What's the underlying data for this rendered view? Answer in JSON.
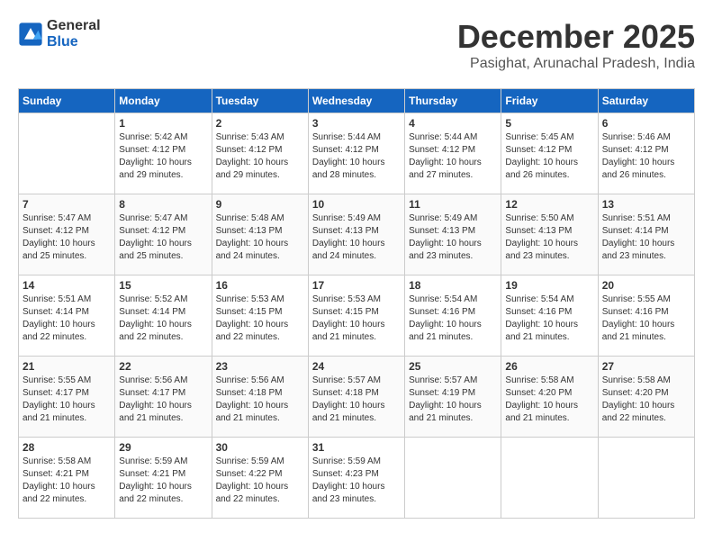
{
  "header": {
    "logo_line1": "General",
    "logo_line2": "Blue",
    "month_title": "December 2025",
    "location": "Pasighat, Arunachal Pradesh, India"
  },
  "weekdays": [
    "Sunday",
    "Monday",
    "Tuesday",
    "Wednesday",
    "Thursday",
    "Friday",
    "Saturday"
  ],
  "weeks": [
    [
      {
        "day": "",
        "info": ""
      },
      {
        "day": "1",
        "info": "Sunrise: 5:42 AM\nSunset: 4:12 PM\nDaylight: 10 hours\nand 29 minutes."
      },
      {
        "day": "2",
        "info": "Sunrise: 5:43 AM\nSunset: 4:12 PM\nDaylight: 10 hours\nand 29 minutes."
      },
      {
        "day": "3",
        "info": "Sunrise: 5:44 AM\nSunset: 4:12 PM\nDaylight: 10 hours\nand 28 minutes."
      },
      {
        "day": "4",
        "info": "Sunrise: 5:44 AM\nSunset: 4:12 PM\nDaylight: 10 hours\nand 27 minutes."
      },
      {
        "day": "5",
        "info": "Sunrise: 5:45 AM\nSunset: 4:12 PM\nDaylight: 10 hours\nand 26 minutes."
      },
      {
        "day": "6",
        "info": "Sunrise: 5:46 AM\nSunset: 4:12 PM\nDaylight: 10 hours\nand 26 minutes."
      }
    ],
    [
      {
        "day": "7",
        "info": "Sunrise: 5:47 AM\nSunset: 4:12 PM\nDaylight: 10 hours\nand 25 minutes."
      },
      {
        "day": "8",
        "info": "Sunrise: 5:47 AM\nSunset: 4:12 PM\nDaylight: 10 hours\nand 25 minutes."
      },
      {
        "day": "9",
        "info": "Sunrise: 5:48 AM\nSunset: 4:13 PM\nDaylight: 10 hours\nand 24 minutes."
      },
      {
        "day": "10",
        "info": "Sunrise: 5:49 AM\nSunset: 4:13 PM\nDaylight: 10 hours\nand 24 minutes."
      },
      {
        "day": "11",
        "info": "Sunrise: 5:49 AM\nSunset: 4:13 PM\nDaylight: 10 hours\nand 23 minutes."
      },
      {
        "day": "12",
        "info": "Sunrise: 5:50 AM\nSunset: 4:13 PM\nDaylight: 10 hours\nand 23 minutes."
      },
      {
        "day": "13",
        "info": "Sunrise: 5:51 AM\nSunset: 4:14 PM\nDaylight: 10 hours\nand 23 minutes."
      }
    ],
    [
      {
        "day": "14",
        "info": "Sunrise: 5:51 AM\nSunset: 4:14 PM\nDaylight: 10 hours\nand 22 minutes."
      },
      {
        "day": "15",
        "info": "Sunrise: 5:52 AM\nSunset: 4:14 PM\nDaylight: 10 hours\nand 22 minutes."
      },
      {
        "day": "16",
        "info": "Sunrise: 5:53 AM\nSunset: 4:15 PM\nDaylight: 10 hours\nand 22 minutes."
      },
      {
        "day": "17",
        "info": "Sunrise: 5:53 AM\nSunset: 4:15 PM\nDaylight: 10 hours\nand 21 minutes."
      },
      {
        "day": "18",
        "info": "Sunrise: 5:54 AM\nSunset: 4:16 PM\nDaylight: 10 hours\nand 21 minutes."
      },
      {
        "day": "19",
        "info": "Sunrise: 5:54 AM\nSunset: 4:16 PM\nDaylight: 10 hours\nand 21 minutes."
      },
      {
        "day": "20",
        "info": "Sunrise: 5:55 AM\nSunset: 4:16 PM\nDaylight: 10 hours\nand 21 minutes."
      }
    ],
    [
      {
        "day": "21",
        "info": "Sunrise: 5:55 AM\nSunset: 4:17 PM\nDaylight: 10 hours\nand 21 minutes."
      },
      {
        "day": "22",
        "info": "Sunrise: 5:56 AM\nSunset: 4:17 PM\nDaylight: 10 hours\nand 21 minutes."
      },
      {
        "day": "23",
        "info": "Sunrise: 5:56 AM\nSunset: 4:18 PM\nDaylight: 10 hours\nand 21 minutes."
      },
      {
        "day": "24",
        "info": "Sunrise: 5:57 AM\nSunset: 4:18 PM\nDaylight: 10 hours\nand 21 minutes."
      },
      {
        "day": "25",
        "info": "Sunrise: 5:57 AM\nSunset: 4:19 PM\nDaylight: 10 hours\nand 21 minutes."
      },
      {
        "day": "26",
        "info": "Sunrise: 5:58 AM\nSunset: 4:20 PM\nDaylight: 10 hours\nand 21 minutes."
      },
      {
        "day": "27",
        "info": "Sunrise: 5:58 AM\nSunset: 4:20 PM\nDaylight: 10 hours\nand 22 minutes."
      }
    ],
    [
      {
        "day": "28",
        "info": "Sunrise: 5:58 AM\nSunset: 4:21 PM\nDaylight: 10 hours\nand 22 minutes."
      },
      {
        "day": "29",
        "info": "Sunrise: 5:59 AM\nSunset: 4:21 PM\nDaylight: 10 hours\nand 22 minutes."
      },
      {
        "day": "30",
        "info": "Sunrise: 5:59 AM\nSunset: 4:22 PM\nDaylight: 10 hours\nand 22 minutes."
      },
      {
        "day": "31",
        "info": "Sunrise: 5:59 AM\nSunset: 4:23 PM\nDaylight: 10 hours\nand 23 minutes."
      },
      {
        "day": "",
        "info": ""
      },
      {
        "day": "",
        "info": ""
      },
      {
        "day": "",
        "info": ""
      }
    ]
  ]
}
